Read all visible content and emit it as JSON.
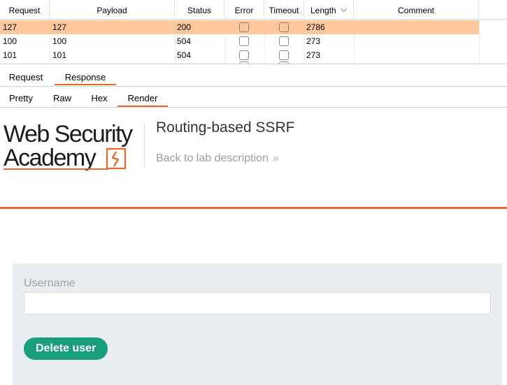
{
  "table": {
    "columns": [
      "Request",
      "Payload",
      "Status",
      "Error",
      "Timeout",
      "Length",
      "Comment"
    ],
    "sort_icon": "chevron-down-icon",
    "rows": [
      {
        "request": "127",
        "payload": "127",
        "status": "200",
        "length": "2786",
        "selected": true
      },
      {
        "request": "100",
        "payload": "100",
        "status": "504",
        "length": "273",
        "selected": false
      },
      {
        "request": "101",
        "payload": "101",
        "status": "504",
        "length": "273",
        "selected": false
      }
    ]
  },
  "message_tabs": [
    "Request",
    "Response"
  ],
  "message_tab_active": "Response",
  "view_tabs": [
    "Pretty",
    "Raw",
    "Hex",
    "Render"
  ],
  "view_tab_active": "Render",
  "page": {
    "logo_line1": "Web Security",
    "logo_line2": "Academy",
    "lab_title": "Routing-based SSRF",
    "back_link": "Back to lab description",
    "back_chevron": "»",
    "form": {
      "username_label": "Username",
      "username_value": "",
      "submit_label": "Delete user"
    }
  },
  "colors": {
    "selected_row": "#ffc79c",
    "accent_orange": "#e8692f",
    "button_green": "#1a9f7c",
    "panel_bg": "#e9eef0"
  }
}
